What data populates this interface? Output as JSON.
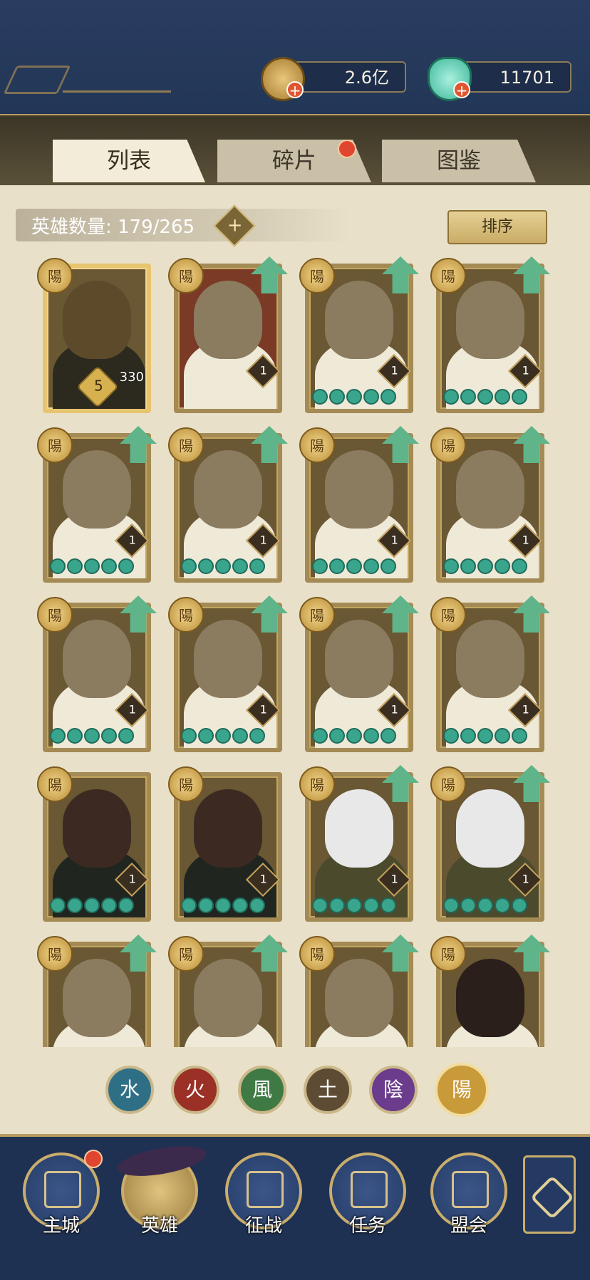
{
  "currency": {
    "coins": "2.6亿",
    "gems": "11701"
  },
  "tabs": [
    {
      "label": "列表",
      "active": true
    },
    {
      "label": "碎片",
      "active": false,
      "badge": true
    },
    {
      "label": "图鉴",
      "active": false
    }
  ],
  "hero_count": {
    "label": "英雄数量: 179/265",
    "add": "+"
  },
  "sort_label": "排序",
  "badge_glyph": "陽",
  "cards": [
    {
      "type": "special",
      "stars": "5",
      "power": "330",
      "upgrade": false
    },
    {
      "type": "red",
      "level": "1",
      "upgrade": true
    },
    {
      "type": "normal",
      "level": "1",
      "stars_count": 5,
      "upgrade": true
    },
    {
      "type": "normal",
      "level": "1",
      "stars_count": 5,
      "upgrade": true
    },
    {
      "type": "normal",
      "level": "1",
      "stars_count": 5,
      "upgrade": true
    },
    {
      "type": "normal",
      "level": "1",
      "stars_count": 5,
      "upgrade": true
    },
    {
      "type": "normal",
      "level": "1",
      "stars_count": 5,
      "upgrade": true
    },
    {
      "type": "normal",
      "level": "1",
      "stars_count": 5,
      "upgrade": true
    },
    {
      "type": "normal",
      "level": "1",
      "stars_count": 5,
      "upgrade": true
    },
    {
      "type": "normal",
      "level": "1",
      "stars_count": 5,
      "upgrade": true
    },
    {
      "type": "normal",
      "level": "1",
      "stars_count": 5,
      "upgrade": true
    },
    {
      "type": "normal",
      "level": "1",
      "stars_count": 5,
      "upgrade": true
    },
    {
      "type": "dark",
      "level": "1",
      "stars_count": 5,
      "upgrade": false
    },
    {
      "type": "dark",
      "level": "1",
      "stars_count": 5,
      "upgrade": false
    },
    {
      "type": "elder",
      "level": "1",
      "stars_count": 5,
      "upgrade": true
    },
    {
      "type": "elder",
      "level": "1",
      "stars_count": 5,
      "upgrade": true
    },
    {
      "type": "normal",
      "upgrade": true
    },
    {
      "type": "normal",
      "upgrade": true
    },
    {
      "type": "normal",
      "upgrade": true
    },
    {
      "type": "lady",
      "upgrade": true
    }
  ],
  "elements": [
    {
      "glyph": "水",
      "color": "#2f6f86"
    },
    {
      "glyph": "火",
      "color": "#9b3026"
    },
    {
      "glyph": "風",
      "color": "#3f7a44"
    },
    {
      "glyph": "土",
      "color": "#5e4b33"
    },
    {
      "glyph": "陰",
      "color": "#6b3b8c"
    },
    {
      "glyph": "陽",
      "color": "#c99a3a"
    }
  ],
  "nav": [
    {
      "label": "主城",
      "badge": true
    },
    {
      "label": "英雄",
      "active": true
    },
    {
      "label": "征战"
    },
    {
      "label": "任务"
    },
    {
      "label": "盟会"
    }
  ]
}
